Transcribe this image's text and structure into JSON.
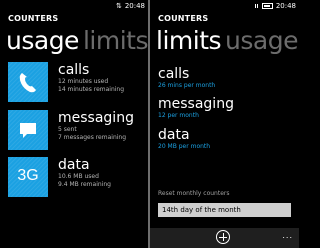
{
  "status": {
    "time": "20:48"
  },
  "left_screen": {
    "app_title": "COUNTERS",
    "pivot_active": "usage",
    "pivot_inactive": "limits",
    "items": [
      {
        "title": "calls",
        "line1": "12 minutes used",
        "line2": "14 minutes remaining",
        "icon": "phone-icon"
      },
      {
        "title": "messaging",
        "line1": "5 sent",
        "line2": "7 messages remaining",
        "icon": "message-icon"
      },
      {
        "title": "data",
        "line1": "10.6 MB used",
        "line2": "9.4 MB remaining",
        "icon": "3g-icon",
        "icon_text": "3G"
      }
    ]
  },
  "right_screen": {
    "app_title": "COUNTERS",
    "pivot_active": "limits",
    "pivot_inactive": "usage",
    "items": [
      {
        "title": "calls",
        "sub": "26 mins per month"
      },
      {
        "title": "messaging",
        "sub": "12 per month"
      },
      {
        "title": "data",
        "sub": "20 MB per month"
      }
    ],
    "reset_label": "Reset monthly counters",
    "reset_value": "14th day of the month",
    "appbar_more": "..."
  },
  "colors": {
    "accent": "#1ba1e2",
    "background": "#000000",
    "inactive_text": "#6c6c6c"
  }
}
